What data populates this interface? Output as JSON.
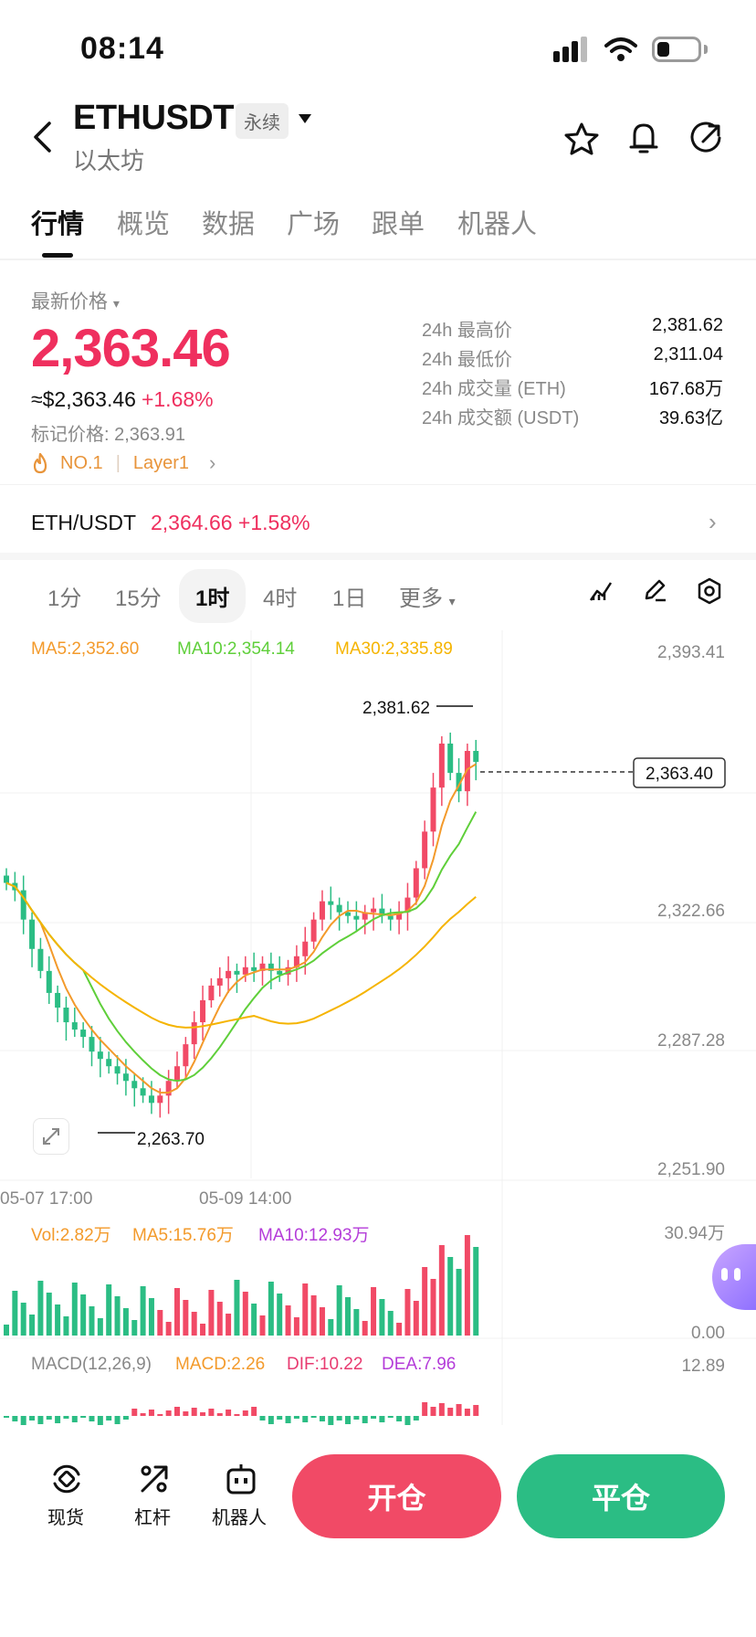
{
  "status_bar": {
    "time": "08:14"
  },
  "header": {
    "symbol": "ETHUSDT",
    "badge": "永续",
    "name": "以太坊"
  },
  "tabs": [
    "行情",
    "概览",
    "数据",
    "广场",
    "跟单",
    "机器人"
  ],
  "price": {
    "label": "最新价格",
    "last": "2,363.46",
    "usd": "≈$2,363.46",
    "change": "+1.68%",
    "mark_label": "标记价格:",
    "mark": "2,363.91",
    "rank": "NO.1",
    "sector": "Layer1"
  },
  "stats": [
    {
      "label": "24h 最高价",
      "value": "2,381.62"
    },
    {
      "label": "24h 最低价",
      "value": "2,311.04"
    },
    {
      "label": "24h 成交量 (ETH)",
      "value": "167.68万"
    },
    {
      "label": "24h 成交额 (USDT)",
      "value": "39.63亿"
    }
  ],
  "spot_pair": {
    "name": "ETH/USDT",
    "price": "2,364.66",
    "change": "+1.58%"
  },
  "intervals": [
    "1分",
    "15分",
    "1时",
    "4时",
    "1日",
    "更多"
  ],
  "chart": {
    "ma": {
      "ma5": "MA5:2,352.60",
      "ma10": "MA10:2,354.14",
      "ma30": "MA30:2,335.89"
    },
    "y_ticks": [
      "2,393.41",
      "2,322.66",
      "2,287.28",
      "2,251.90"
    ],
    "current_price": "2,363.40",
    "high_label": "2,381.62",
    "low_label": "2,263.70",
    "x_ticks": [
      "05-07 17:00",
      "05-09 14:00"
    ],
    "vol": {
      "vol": "Vol:2.82万",
      "ma5": "MA5:15.76万",
      "ma10": "MA10:12.93万",
      "max": "30.94万",
      "zero": "0.00"
    },
    "macd": {
      "title": "MACD(12,26,9)",
      "macd": "MACD:2.26",
      "dif": "DIF:10.22",
      "dea": "DEA:7.96",
      "max": "12.89"
    },
    "colors": {
      "up": "#f14a66",
      "down": "#2bbd84",
      "ma5": "#f39a2b",
      "ma10": "#5fcf3a",
      "ma30": "#f5b400",
      "macd_dif": "#e83aa4",
      "macd_dea": "#9b3cf0"
    }
  },
  "chart_data": {
    "type": "candlestick",
    "interval": "1时",
    "ylim": [
      2251.9,
      2393.41
    ],
    "high": 2381.62,
    "low": 2263.7,
    "last": 2363.4,
    "closes": [
      2330,
      2328,
      2320,
      2312,
      2306,
      2300,
      2296,
      2292,
      2290,
      2288,
      2284,
      2282,
      2280,
      2278,
      2276,
      2274,
      2272,
      2270,
      2272,
      2276,
      2280,
      2286,
      2292,
      2298,
      2302,
      2304,
      2306,
      2305,
      2307,
      2306,
      2308,
      2306,
      2305,
      2307,
      2310,
      2314,
      2320,
      2325,
      2324,
      2322,
      2321,
      2320,
      2322,
      2323,
      2321,
      2320,
      2322,
      2326,
      2334,
      2344,
      2356,
      2368,
      2360,
      2355,
      2366,
      2363
    ],
    "volume_max": "30.94万"
  },
  "bottom_nav": [
    {
      "label": "现货",
      "icon": "spot-icon"
    },
    {
      "label": "杠杆",
      "icon": "margin-icon"
    },
    {
      "label": "机器人",
      "icon": "robot-icon"
    }
  ],
  "actions": {
    "open": "开仓",
    "close": "平仓"
  }
}
